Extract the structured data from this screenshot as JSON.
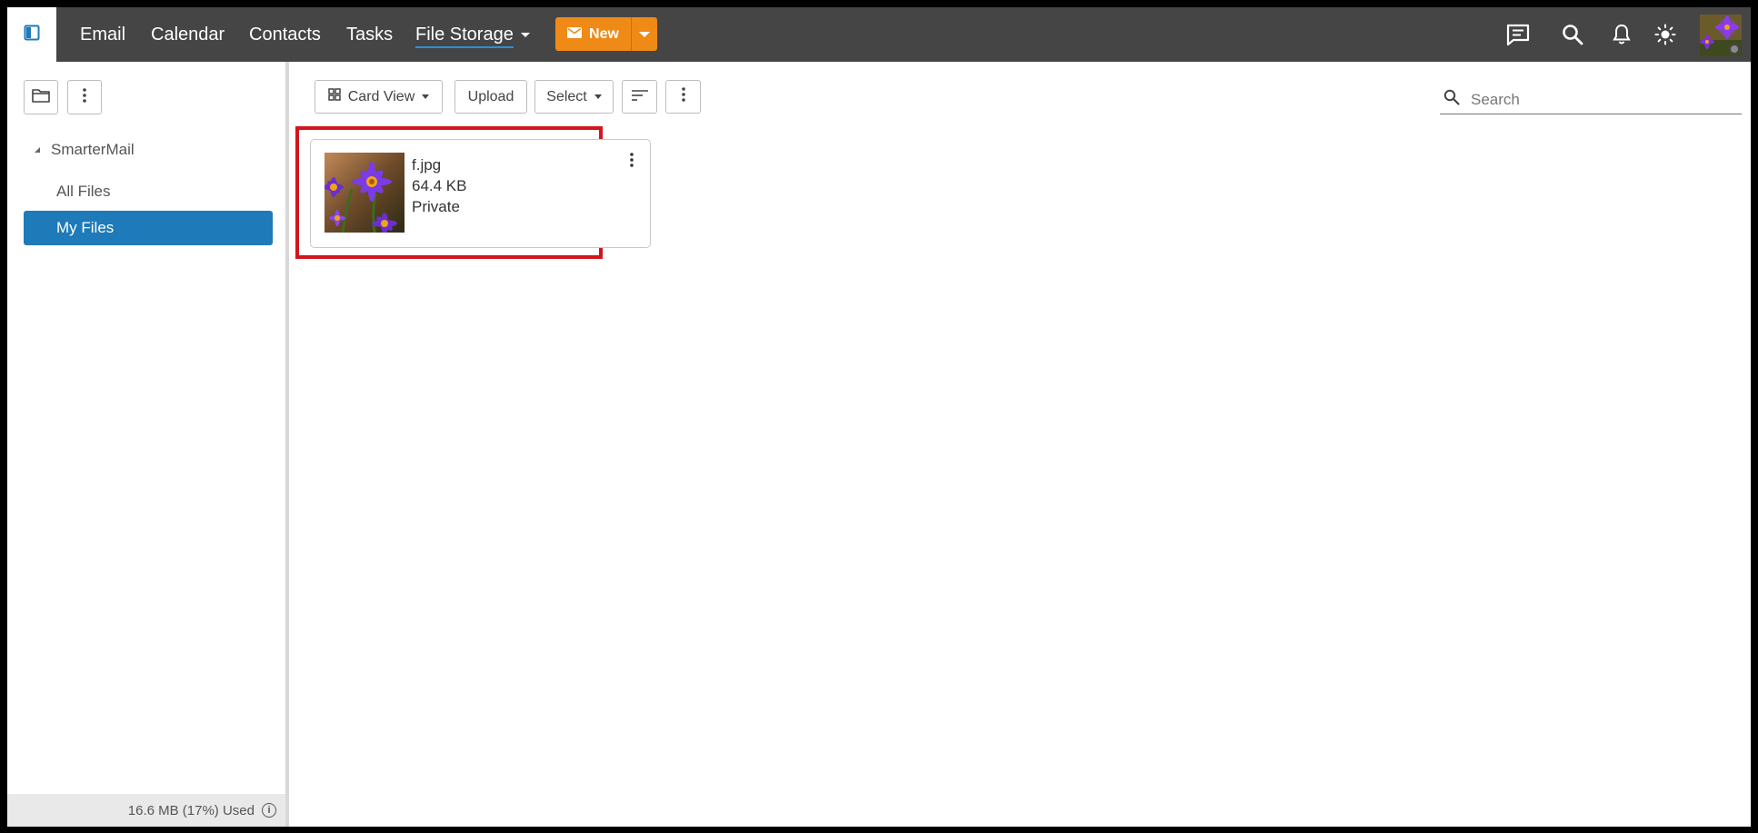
{
  "topbar": {
    "nav": [
      "Email",
      "Calendar",
      "Contacts",
      "Tasks",
      "File Storage"
    ],
    "new_label": "New",
    "icons": [
      "sidebar-toggle-icon",
      "chat-icon",
      "search-icon",
      "bell-icon",
      "sun-icon"
    ],
    "accent_color": "#ef8a17"
  },
  "sidebar": {
    "root_label": "SmarterMail",
    "items": [
      {
        "label": "All Files",
        "selected": false
      },
      {
        "label": "My Files",
        "selected": true
      }
    ],
    "storage_used": "16.6 MB (17%) Used",
    "selected_color": "#1e7ab8"
  },
  "toolbar": {
    "view_label": "Card View",
    "upload_label": "Upload",
    "select_label": "Select",
    "search_placeholder": "Search"
  },
  "files": [
    {
      "name": "f.jpg",
      "size": "64.4 KB",
      "visibility": "Private"
    }
  ]
}
